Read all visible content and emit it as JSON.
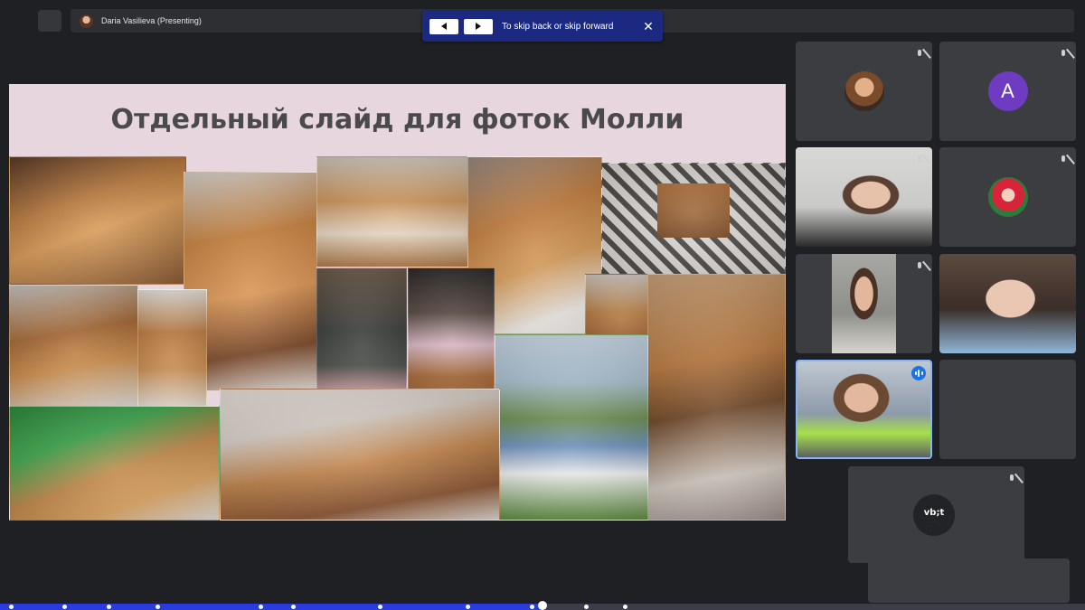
{
  "presenter": {
    "name": "Daria Vasilieva (Presenting)"
  },
  "skip_banner": {
    "text": "To skip back or skip forward",
    "back_icon": "play-back-icon",
    "forward_icon": "play-forward-icon",
    "close_icon": "close-icon"
  },
  "slide": {
    "title": "Отдельный слайд для фоток Молли",
    "background": "#e8d6df"
  },
  "participants": [
    {
      "type": "avatar-photo",
      "muted": true
    },
    {
      "type": "avatar-letter",
      "letter": "A",
      "color": "#6e3bc1",
      "muted": true
    },
    {
      "type": "video",
      "muted": true
    },
    {
      "type": "avatar-photo",
      "muted": true
    },
    {
      "type": "video",
      "muted": true
    },
    {
      "type": "video",
      "muted": false
    },
    {
      "type": "video",
      "speaking": true,
      "active": true
    },
    {
      "type": "empty"
    }
  ],
  "logo_tile": {
    "logo_text": "vb;t",
    "muted": true
  },
  "progress": {
    "played_fraction": 0.5,
    "accent": "#2a3ce0"
  }
}
